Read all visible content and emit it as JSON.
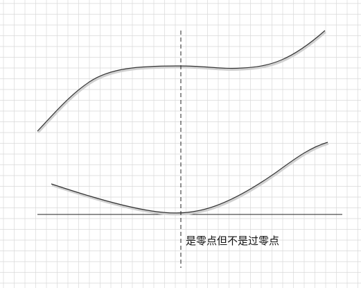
{
  "annotation": "是零点但不是过零点",
  "colors": {
    "background": "#ffffff",
    "grid": "#d9d9d9",
    "curve": "#333333",
    "curve_shadow": "#cfcfcf",
    "axis": "#222222",
    "dashed_line": "#222222",
    "text": "#111111"
  }
}
